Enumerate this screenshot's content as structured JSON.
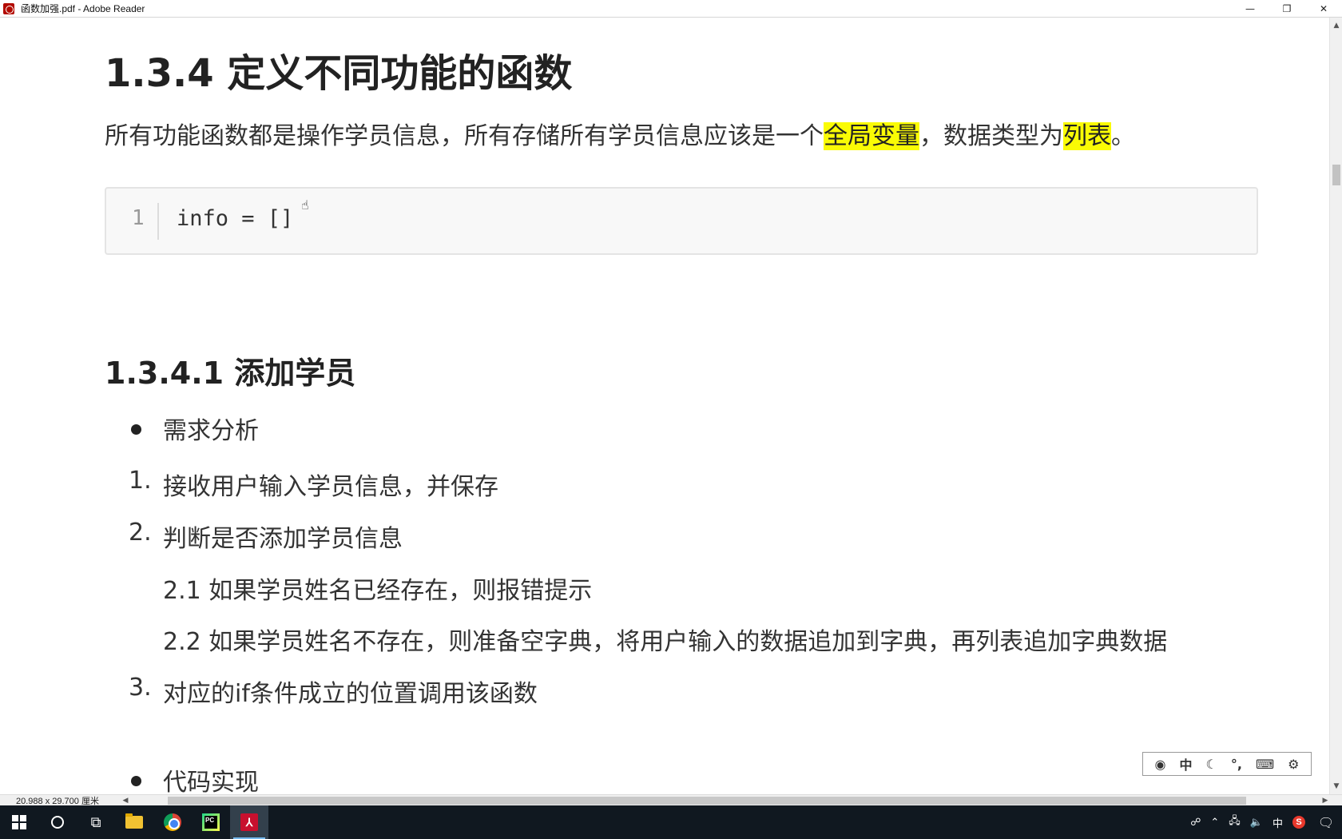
{
  "window": {
    "title": "函数加强.pdf - Adobe Reader",
    "minimize": "—",
    "restore": "❐",
    "close": "✕"
  },
  "document": {
    "heading1": "1.3.4 定义不同功能的函数",
    "intro": {
      "part1": "所有功能函数都是操作学员信息，所有存储所有学员信息应该是一个",
      "highlight1": "全局变量",
      "part2": "，数据类型为",
      "highlight2": "列表",
      "part3": "。"
    },
    "code": {
      "line_number": "1",
      "line_text": "info = []"
    },
    "heading2": "1.3.4.1 添加学员",
    "bullets": {
      "analysis": "需求分析",
      "implementation": "代码实现"
    },
    "steps": [
      {
        "num": "1.",
        "text": "接收用户输入学员信息，并保存"
      },
      {
        "num": "2.",
        "text": "判断是否添加学员信息"
      },
      {
        "num": "",
        "text": "2.1 如果学员姓名已经存在，则报错提示"
      },
      {
        "num": "",
        "text": "2.2 如果学员姓名不存在，则准备空字典，将用户输入的数据追加到字典，再列表追加字典数据"
      },
      {
        "num": "3.",
        "text": "对应的if条件成立的位置调用该函数"
      }
    ]
  },
  "statusbar": {
    "page_size": "20.988 x 29.700 厘米"
  },
  "ime_bar": {
    "mode": "中",
    "icons": [
      "sogou-logo-icon",
      "moon-icon",
      "punctuation-icon",
      "keyboard-icon",
      "gear-icon"
    ]
  },
  "taskbar": {
    "apps": [
      "windows-start-icon",
      "cortana-search-icon",
      "task-view-icon",
      "file-explorer-icon",
      "chrome-icon",
      "pycharm-icon",
      "adobe-reader-icon"
    ],
    "tray_ime": "中",
    "tray_sogou": "S"
  },
  "colors": {
    "highlight": "#fafb05",
    "taskbar": "#101820",
    "code_bg": "#f8f8f8"
  }
}
